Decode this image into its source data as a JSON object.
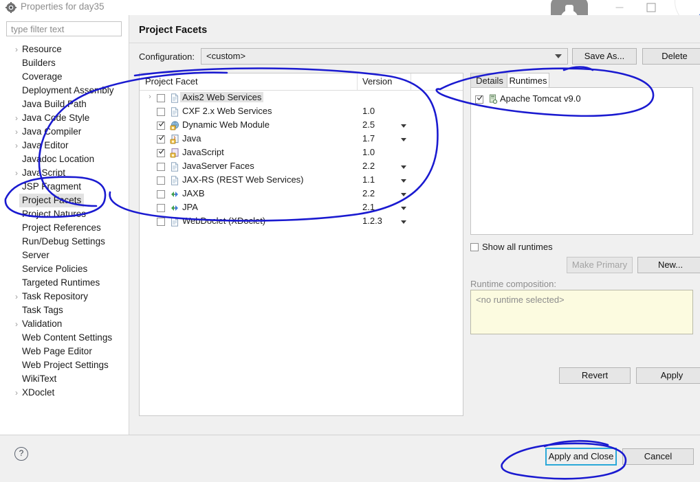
{
  "window": {
    "title": "Properties for day35",
    "icon": "properties-gear-icon",
    "minimize": "minimize-button",
    "maximize": "maximize-button"
  },
  "nav": {
    "back": "back-arrow-icon",
    "forward": "forward-arrow-icon"
  },
  "filter": {
    "placeholder": "type filter text",
    "value": ""
  },
  "sidebar": {
    "items": [
      {
        "label": "Resource",
        "expandable": true,
        "selected": false
      },
      {
        "label": "Builders",
        "expandable": false,
        "selected": false
      },
      {
        "label": "Coverage",
        "expandable": false,
        "selected": false
      },
      {
        "label": "Deployment Assembly",
        "expandable": false,
        "selected": false
      },
      {
        "label": "Java Build Path",
        "expandable": false,
        "selected": false
      },
      {
        "label": "Java Code Style",
        "expandable": true,
        "selected": false
      },
      {
        "label": "Java Compiler",
        "expandable": true,
        "selected": false
      },
      {
        "label": "Java Editor",
        "expandable": true,
        "selected": false
      },
      {
        "label": "Javadoc Location",
        "expandable": false,
        "selected": false
      },
      {
        "label": "JavaScript",
        "expandable": true,
        "selected": false
      },
      {
        "label": "JSP Fragment",
        "expandable": false,
        "selected": false
      },
      {
        "label": "Project Facets",
        "expandable": false,
        "selected": true
      },
      {
        "label": "Project Natures",
        "expandable": false,
        "selected": false
      },
      {
        "label": "Project References",
        "expandable": false,
        "selected": false
      },
      {
        "label": "Run/Debug Settings",
        "expandable": false,
        "selected": false
      },
      {
        "label": "Server",
        "expandable": false,
        "selected": false
      },
      {
        "label": "Service Policies",
        "expandable": false,
        "selected": false
      },
      {
        "label": "Targeted Runtimes",
        "expandable": false,
        "selected": false
      },
      {
        "label": "Task Repository",
        "expandable": true,
        "selected": false
      },
      {
        "label": "Task Tags",
        "expandable": false,
        "selected": false
      },
      {
        "label": "Validation",
        "expandable": true,
        "selected": false
      },
      {
        "label": "Web Content Settings",
        "expandable": false,
        "selected": false
      },
      {
        "label": "Web Page Editor",
        "expandable": false,
        "selected": false
      },
      {
        "label": "Web Project Settings",
        "expandable": false,
        "selected": false
      },
      {
        "label": "WikiText",
        "expandable": false,
        "selected": false
      },
      {
        "label": "XDoclet",
        "expandable": true,
        "selected": false
      }
    ]
  },
  "page": {
    "title": "Project Facets",
    "configuration": {
      "label": "Configuration:",
      "value": "<custom>",
      "save_as_label": "Save As...",
      "delete_label": "Delete"
    },
    "facet_table": {
      "columns": [
        "Project Facet",
        "Version"
      ],
      "rows": [
        {
          "name": "Axis2 Web Services",
          "version": "",
          "checked": false,
          "expandable": true,
          "selected": true,
          "has_version_menu": false,
          "icon": "facet-doc-icon"
        },
        {
          "name": "CXF 2.x Web Services",
          "version": "1.0",
          "checked": false,
          "expandable": false,
          "selected": false,
          "has_version_menu": false,
          "icon": "facet-doc-icon"
        },
        {
          "name": "Dynamic Web Module",
          "version": "2.5",
          "checked": true,
          "expandable": false,
          "selected": false,
          "has_version_menu": true,
          "icon": "facet-web-icon"
        },
        {
          "name": "Java",
          "version": "1.7",
          "checked": true,
          "expandable": false,
          "selected": false,
          "has_version_menu": true,
          "icon": "facet-java-icon"
        },
        {
          "name": "JavaScript",
          "version": "1.0",
          "checked": true,
          "expandable": false,
          "selected": false,
          "has_version_menu": false,
          "icon": "facet-js-icon"
        },
        {
          "name": "JavaServer Faces",
          "version": "2.2",
          "checked": false,
          "expandable": false,
          "selected": false,
          "has_version_menu": true,
          "icon": "facet-doc-icon"
        },
        {
          "name": "JAX-RS (REST Web Services)",
          "version": "1.1",
          "checked": false,
          "expandable": false,
          "selected": false,
          "has_version_menu": true,
          "icon": "facet-doc-icon"
        },
        {
          "name": "JAXB",
          "version": "2.2",
          "checked": false,
          "expandable": false,
          "selected": false,
          "has_version_menu": true,
          "icon": "facet-arrows-icon"
        },
        {
          "name": "JPA",
          "version": "2.1",
          "checked": false,
          "expandable": false,
          "selected": false,
          "has_version_menu": true,
          "icon": "facet-arrows-icon"
        },
        {
          "name": "WebDoclet (XDoclet)",
          "version": "1.2.3",
          "checked": false,
          "expandable": false,
          "selected": false,
          "has_version_menu": true,
          "icon": "facet-doc-icon"
        }
      ]
    },
    "tabs": [
      {
        "label": "Details",
        "active": false
      },
      {
        "label": "Runtimes",
        "active": true
      }
    ],
    "runtimes": [
      {
        "label": "Apache Tomcat v9.0",
        "checked": true,
        "icon": "server-icon"
      }
    ],
    "show_all_runtimes": {
      "label": "Show all runtimes",
      "checked": false
    },
    "make_primary_label": "Make Primary",
    "new_label": "New...",
    "runtime_composition": {
      "label": "Runtime composition:",
      "value": "<no runtime selected>"
    },
    "revert_label": "Revert",
    "apply_label": "Apply"
  },
  "footer": {
    "help": "?",
    "apply_and_close_label": "Apply and Close",
    "cancel_label": "Cancel"
  },
  "colors": {
    "ink": "#1a1ad0",
    "focus": "#2aa8d8",
    "selection": "#e2e2e2",
    "composition_bg": "#fcfbe0"
  }
}
